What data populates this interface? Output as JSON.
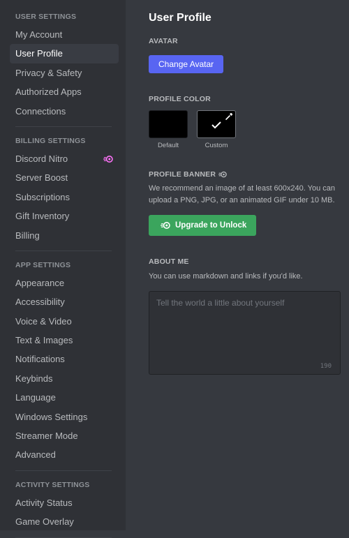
{
  "sidebar": {
    "user_settings": {
      "header": "USER SETTINGS",
      "items": [
        "My Account",
        "User Profile",
        "Privacy & Safety",
        "Authorized Apps",
        "Connections"
      ],
      "active": "User Profile"
    },
    "billing_settings": {
      "header": "BILLING SETTINGS",
      "items": [
        "Discord Nitro",
        "Server Boost",
        "Subscriptions",
        "Gift Inventory",
        "Billing"
      ]
    },
    "app_settings": {
      "header": "APP SETTINGS",
      "items": [
        "Appearance",
        "Accessibility",
        "Voice & Video",
        "Text & Images",
        "Notifications",
        "Keybinds",
        "Language",
        "Windows Settings",
        "Streamer Mode",
        "Advanced"
      ]
    },
    "activity_settings": {
      "header": "ACTIVITY SETTINGS",
      "items": [
        "Activity Status",
        "Game Overlay"
      ]
    }
  },
  "main": {
    "title": "User Profile",
    "avatar": {
      "label": "AVATAR",
      "button": "Change Avatar"
    },
    "profile_color": {
      "label": "PROFILE COLOR",
      "default_caption": "Default",
      "custom_caption": "Custom",
      "selected": "Custom",
      "default_color": "#000000",
      "custom_color": "#000000"
    },
    "profile_banner": {
      "label": "PROFILE BANNER",
      "description": "We recommend an image of at least 600x240. You can upload a PNG, JPG, or an animated GIF under 10 MB.",
      "button": "Upgrade to Unlock"
    },
    "about_me": {
      "label": "ABOUT ME",
      "description": "You can use markdown and links if you'd like.",
      "placeholder": "Tell the world a little about yourself",
      "counter": "190"
    }
  },
  "colors": {
    "accent": "#5865f2",
    "green": "#3ba55d",
    "nitro": "#ff73fa",
    "sidebar_bg": "#2f3136",
    "main_bg": "#36393f"
  }
}
